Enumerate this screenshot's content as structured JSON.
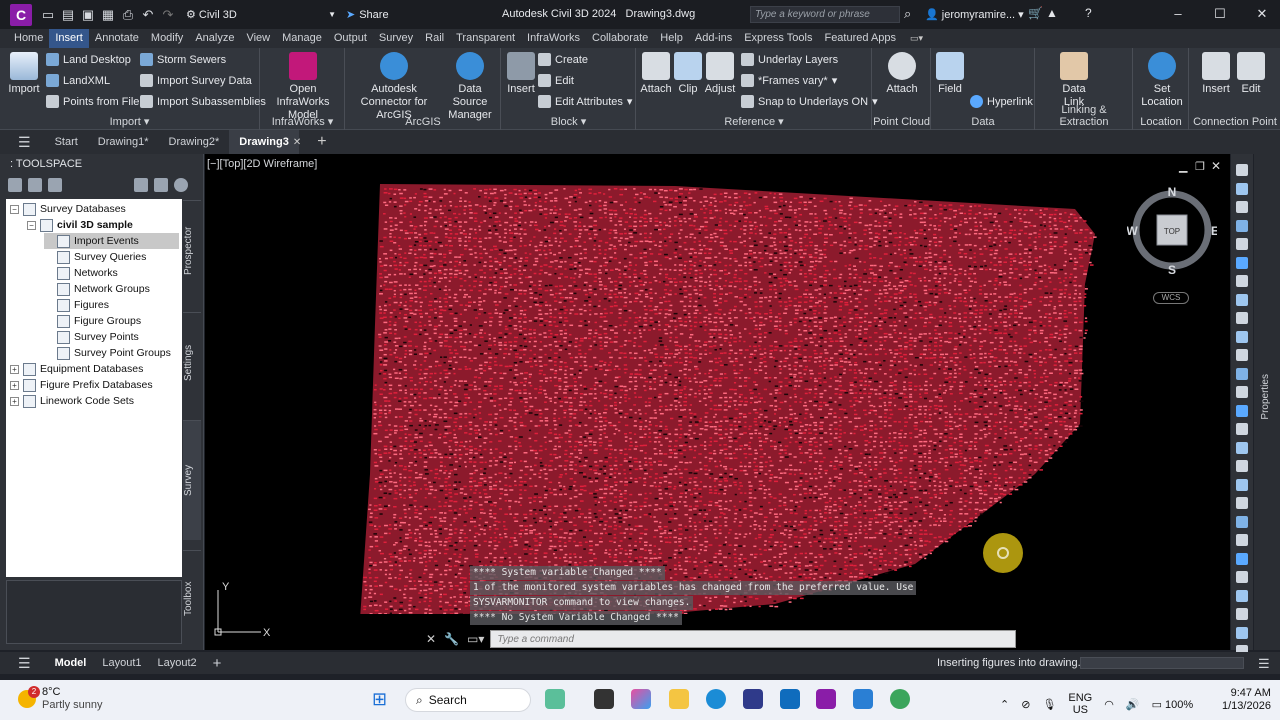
{
  "titlebar": {
    "workspace": "Civil 3D",
    "share_label": "Share",
    "app_title": "Autodesk Civil 3D 2024",
    "doc_name": "Drawing3.dwg",
    "search_placeholder": "Type a keyword or phrase",
    "user": "jeromyramire...",
    "app_letter": "C"
  },
  "ribbon_tabs": [
    "Home",
    "Insert",
    "Annotate",
    "Modify",
    "Analyze",
    "View",
    "Manage",
    "Output",
    "Survey",
    "Rail",
    "Transparent",
    "InfraWorks",
    "Collaborate",
    "Help",
    "Add-ins",
    "Express Tools",
    "Featured Apps"
  ],
  "active_tab": "Insert",
  "ribbon": {
    "import": {
      "title": "Import",
      "big": "Import",
      "items": [
        "Land Desktop",
        "LandXML",
        "Points from File",
        "Storm Sewers",
        "Import Survey Data",
        "Import Subassemblies"
      ]
    },
    "infraworks": {
      "title": "InfraWorks",
      "big": "Open InfraWorks Model"
    },
    "arcgis": {
      "title": "ArcGIS",
      "big1": "Autodesk Connector for ArcGIS",
      "big2": "Data Source Manager"
    },
    "block": {
      "title": "Block",
      "big": "Insert",
      "items": [
        "Create",
        "Edit",
        "Edit Attributes"
      ]
    },
    "reference": {
      "title": "Reference",
      "big": [
        "Attach",
        "Clip",
        "Adjust"
      ],
      "items": [
        "Underlay Layers",
        "*Frames vary*",
        "Snap to Underlays ON"
      ]
    },
    "pointcloud": {
      "title": "Point Cloud",
      "big": "Attach"
    },
    "data": {
      "title": "Data",
      "big": "Field",
      "items": [
        "Hyperlink"
      ]
    },
    "linking": {
      "title": "Linking & Extraction",
      "big": "Data Link"
    },
    "location": {
      "title": "Location",
      "big": "Set Location"
    },
    "connection": {
      "title": "Connection Point",
      "big": [
        "Insert",
        "Edit"
      ]
    }
  },
  "doc_tabs": [
    "Start",
    "Drawing1*",
    "Drawing2*",
    "Drawing3"
  ],
  "active_doc": "Drawing3",
  "toolspace": {
    "title": "TOOLSPACE",
    "tree": [
      {
        "label": "Survey Databases",
        "level": 0,
        "expander": "−"
      },
      {
        "label": "civil 3D sample",
        "level": 1,
        "expander": "−",
        "bold": true
      },
      {
        "label": "Import Events",
        "level": 2,
        "selected": true
      },
      {
        "label": "Survey Queries",
        "level": 2
      },
      {
        "label": "Networks",
        "level": 2
      },
      {
        "label": "Network Groups",
        "level": 2
      },
      {
        "label": "Figures",
        "level": 2
      },
      {
        "label": "Figure Groups",
        "level": 2
      },
      {
        "label": "Survey Points",
        "level": 2
      },
      {
        "label": "Survey Point Groups",
        "level": 2
      },
      {
        "label": "Equipment Databases",
        "level": 0,
        "expander": "+"
      },
      {
        "label": "Figure Prefix Databases",
        "level": 0,
        "expander": "+"
      },
      {
        "label": "Linework Code Sets",
        "level": 0,
        "expander": "+"
      }
    ],
    "side_tabs": [
      "Prospector",
      "Settings",
      "Survey",
      "Toolbox"
    ]
  },
  "viewport": {
    "label": "[−][Top][2D Wireframe]",
    "compass": {
      "n": "N",
      "s": "S",
      "e": "E",
      "w": "W",
      "top": "TOP"
    },
    "wcs": "WCS",
    "ucs_x": "X",
    "ucs_y": "Y",
    "point_color": "#ff3050"
  },
  "command": {
    "history": [
      "**** System variable Changed ****",
      "1 of the monitored system variables has changed from the preferred value. Use",
      "SYSVARMONITOR command to view changes.",
      "**** No System Variable Changed ****"
    ],
    "placeholder": "Type a command"
  },
  "properties_label": "Properties",
  "status": {
    "layouts": [
      "Model",
      "Layout1",
      "Layout2"
    ],
    "active": "Model",
    "message": "Inserting figures into drawing."
  },
  "taskbar": {
    "temp": "8°C",
    "weather": "Partly sunny",
    "badge": "2",
    "search": "Search",
    "lang1": "ENG",
    "lang2": "US",
    "battery": "100%",
    "time": "9:47 AM",
    "date": "1/13/2026"
  }
}
